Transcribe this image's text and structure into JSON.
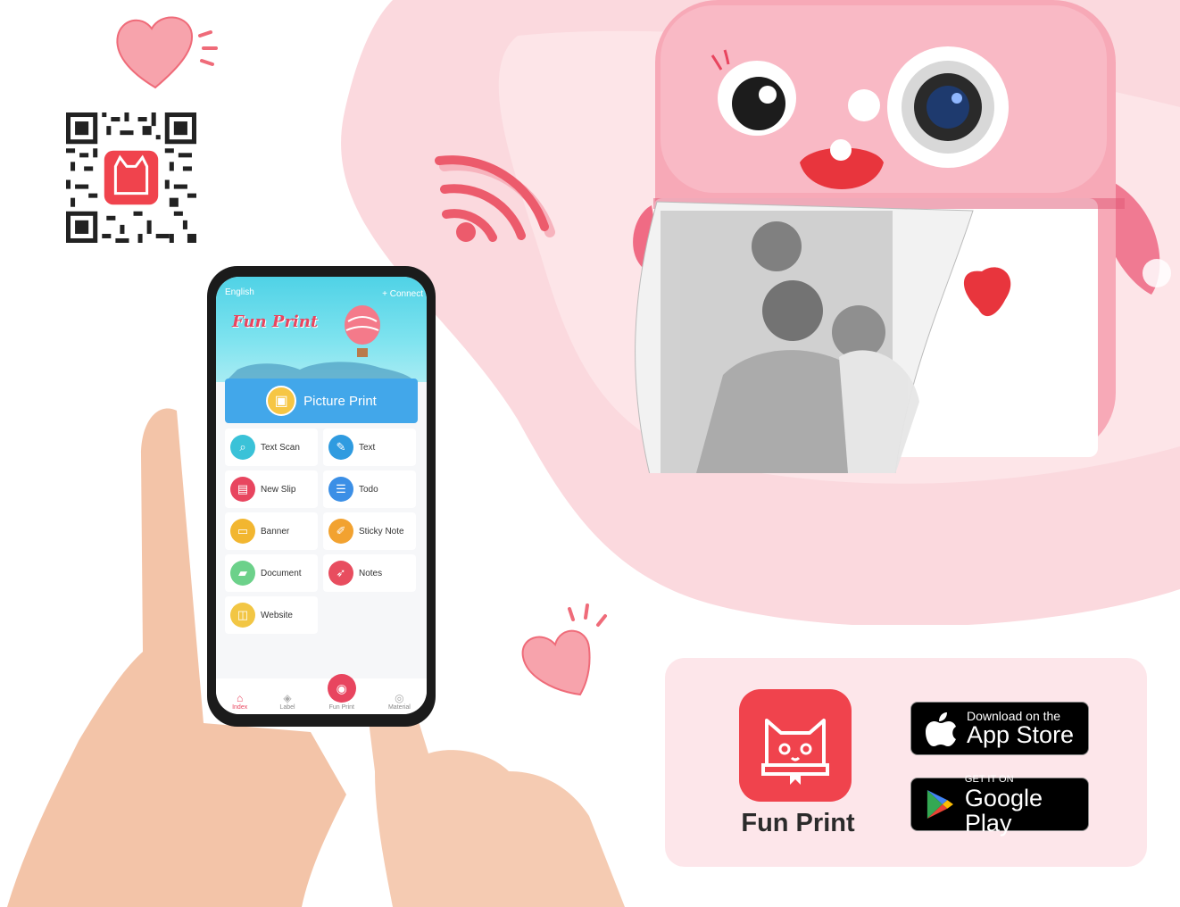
{
  "phone_app": {
    "language": "English",
    "connect": "+ Connect",
    "title": "Fun Print",
    "primary_action": "Picture Print",
    "menu": [
      {
        "label": "Text Scan",
        "icon": "scan-icon",
        "color": "#3ac2d8"
      },
      {
        "label": "Text",
        "icon": "pencil-icon",
        "color": "#2f9be0"
      },
      {
        "label": "New Slip",
        "icon": "slip-icon",
        "color": "#e8455f"
      },
      {
        "label": "Todo",
        "icon": "todo-icon",
        "color": "#3b8fe6"
      },
      {
        "label": "Banner",
        "icon": "banner-icon",
        "color": "#f2b630"
      },
      {
        "label": "Sticky Note",
        "icon": "sticky-note-icon",
        "color": "#f2a230"
      },
      {
        "label": "Document",
        "icon": "folder-icon",
        "color": "#6cd18a"
      },
      {
        "label": "Notes",
        "icon": "rocket-icon",
        "color": "#e84d5f"
      },
      {
        "label": "Website",
        "icon": "website-icon",
        "color": "#f2c644"
      }
    ],
    "nav": [
      {
        "label": "Index",
        "icon": "home-icon",
        "active": true
      },
      {
        "label": "Label",
        "icon": "tag-icon",
        "active": false
      },
      {
        "label": "Fun Print",
        "icon": "cat-icon",
        "active": false
      },
      {
        "label": "Material",
        "icon": "material-icon",
        "active": false
      }
    ]
  },
  "card": {
    "app_name": "Fun Print",
    "app_store": {
      "small": "Download on the",
      "big": "App Store"
    },
    "google_play": {
      "small": "GET IT ON",
      "big": "Google Play"
    }
  },
  "colors": {
    "brand_red": "#f0434d",
    "printer_pink": "#f7a9b7",
    "card_bg": "#fde6ea"
  }
}
